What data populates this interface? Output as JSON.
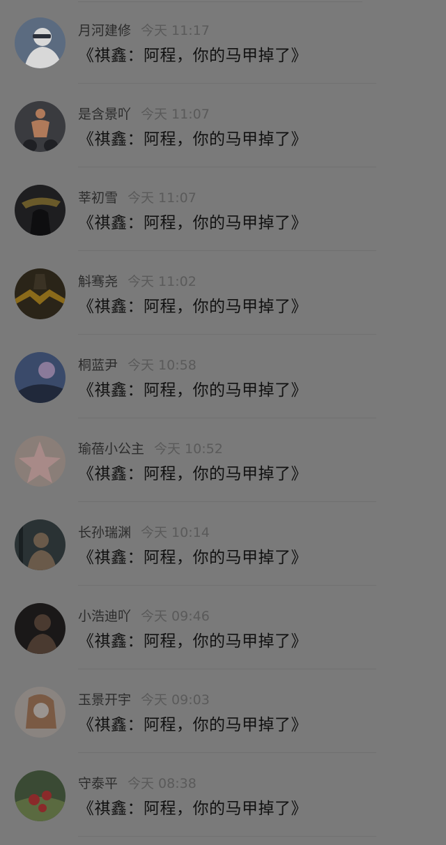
{
  "comments": [
    {
      "name": "月河建修",
      "time": "今天 11:17",
      "text": "《祺鑫：阿程，你的马甲掉了》",
      "avatar": {
        "bg": "#5b6b80",
        "fg": "#d8d8d8",
        "accent": "#2a2f3a"
      }
    },
    {
      "name": "是含景吖",
      "time": "今天 11:07",
      "text": "《祺鑫：阿程，你的马甲掉了》",
      "avatar": {
        "bg": "#3a3b3f",
        "fg": "#b07a5a",
        "accent": "#1f2024"
      }
    },
    {
      "name": "莘初雪",
      "time": "今天 11:07",
      "text": "《祺鑫：阿程，你的马甲掉了》",
      "avatar": {
        "bg": "#1e1e20",
        "fg": "#6a5a2a",
        "accent": "#0e0e10"
      }
    },
    {
      "name": "斛骞尧",
      "time": "今天 11:02",
      "text": "《祺鑫：阿程，你的马甲掉了》",
      "avatar": {
        "bg": "#2a2418",
        "fg": "#8a6a1a",
        "accent": "#3a3224"
      }
    },
    {
      "name": "桐蓝尹",
      "time": "今天 10:58",
      "text": "《祺鑫：阿程，你的马甲掉了》",
      "avatar": {
        "bg": "#3a4a6a",
        "fg": "#8a7a9a",
        "accent": "#20283a"
      }
    },
    {
      "name": "瑜蓓小公主",
      "time": "今天 10:52",
      "text": "《祺鑫：阿程，你的马甲掉了》",
      "avatar": {
        "bg": "#8a7e78",
        "fg": "#a88a88",
        "accent": "#7a6e68"
      }
    },
    {
      "name": "长孙瑞渊",
      "time": "今天 10:14",
      "text": "《祺鑫：阿程，你的马甲掉了》",
      "avatar": {
        "bg": "#2a3234",
        "fg": "#6a5a4a",
        "accent": "#1a2022"
      }
    },
    {
      "name": "小浩迪吖",
      "time": "今天 09:46",
      "text": "《祺鑫：阿程，你的马甲掉了》",
      "avatar": {
        "bg": "#1a1818",
        "fg": "#4a3a30",
        "accent": "#0e0c0c"
      }
    },
    {
      "name": "玉景开宇",
      "time": "今天 09:03",
      "text": "《祺鑫：阿程，你的马甲掉了》",
      "avatar": {
        "bg": "#8a8480",
        "fg": "#7a5a44",
        "accent": "#9a9490"
      }
    },
    {
      "name": "守泰平",
      "time": "今天 08:38",
      "text": "《祺鑫：阿程，你的马甲掉了》",
      "avatar": {
        "bg": "#3a4a34",
        "fg": "#8a2a2a",
        "accent": "#5a6a40"
      }
    }
  ]
}
